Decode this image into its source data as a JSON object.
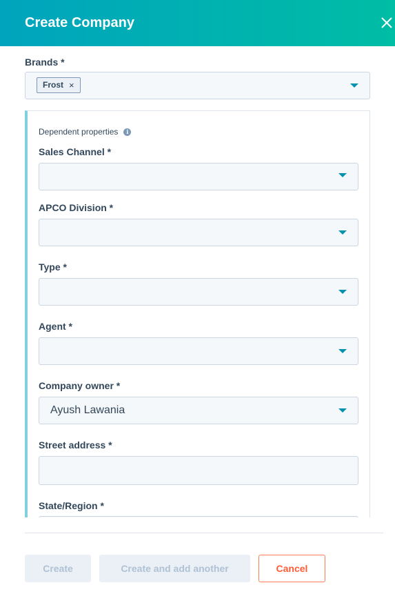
{
  "header": {
    "title": "Create Company"
  },
  "brands": {
    "label": "Brands *",
    "tag": "Frost",
    "tag_remove": "×"
  },
  "dependent": {
    "title": "Dependent properties",
    "info": "i",
    "fields": [
      {
        "label": "Sales Channel *",
        "value": ""
      },
      {
        "label": "APCO Division *",
        "value": ""
      },
      {
        "label": "Type *",
        "value": ""
      },
      {
        "label": "Agent *",
        "value": ""
      },
      {
        "label": "Company owner *",
        "value": "Ayush Lawania"
      },
      {
        "label": "Street address *",
        "value": ""
      },
      {
        "label": "State/Region *",
        "value": ""
      }
    ]
  },
  "footer": {
    "create": "Create",
    "create_another": "Create and add another",
    "cancel": "Cancel"
  },
  "colors": {
    "header_start": "#00a4bd",
    "header_end": "#00bda5",
    "accent": "#0091ae",
    "cancel": "#ff5c35"
  }
}
